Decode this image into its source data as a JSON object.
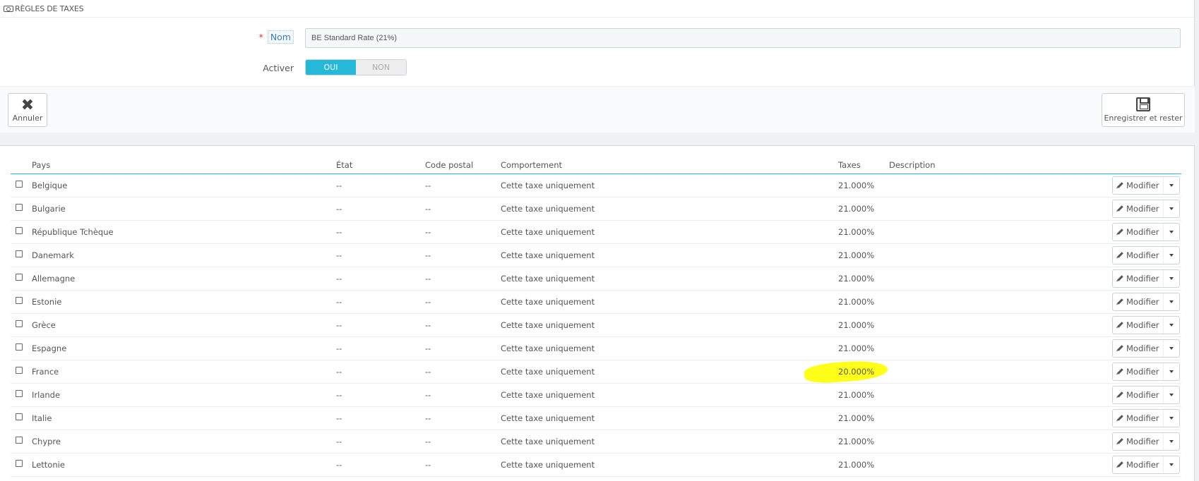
{
  "header": {
    "title": "RÈGLES DE TAXES",
    "icon": "money-icon"
  },
  "form": {
    "name_label": "Nom",
    "name_required": "*",
    "name_value": "BE Standard Rate (21%)",
    "active_label": "Activer",
    "toggle_on": "OUI",
    "toggle_off": "NON",
    "toggle_state": "on"
  },
  "footer": {
    "cancel_label": "Annuler",
    "cancel_icon": "close-icon",
    "save_label": "Enregistrer et rester",
    "save_icon": "save-icon"
  },
  "table": {
    "headers": [
      "Pays",
      "État",
      "Code postal",
      "Comportement",
      "Taxes",
      "Description"
    ],
    "action_label": "Modifier",
    "rows": [
      {
        "pays": "Belgique",
        "etat": "--",
        "cp": "--",
        "comp": "Cette taxe uniquement",
        "tax": "21.000%",
        "desc": ""
      },
      {
        "pays": "Bulgarie",
        "etat": "--",
        "cp": "--",
        "comp": "Cette taxe uniquement",
        "tax": "21.000%",
        "desc": ""
      },
      {
        "pays": "République Tchèque",
        "etat": "--",
        "cp": "--",
        "comp": "Cette taxe uniquement",
        "tax": "21.000%",
        "desc": ""
      },
      {
        "pays": "Danemark",
        "etat": "--",
        "cp": "--",
        "comp": "Cette taxe uniquement",
        "tax": "21.000%",
        "desc": ""
      },
      {
        "pays": "Allemagne",
        "etat": "--",
        "cp": "--",
        "comp": "Cette taxe uniquement",
        "tax": "21.000%",
        "desc": ""
      },
      {
        "pays": "Estonie",
        "etat": "--",
        "cp": "--",
        "comp": "Cette taxe uniquement",
        "tax": "21.000%",
        "desc": ""
      },
      {
        "pays": "Grèce",
        "etat": "--",
        "cp": "--",
        "comp": "Cette taxe uniquement",
        "tax": "21.000%",
        "desc": ""
      },
      {
        "pays": "Espagne",
        "etat": "--",
        "cp": "--",
        "comp": "Cette taxe uniquement",
        "tax": "21.000%",
        "desc": ""
      },
      {
        "pays": "France",
        "etat": "--",
        "cp": "--",
        "comp": "Cette taxe uniquement",
        "tax": "20.000%",
        "desc": "",
        "highlight": true
      },
      {
        "pays": "Irlande",
        "etat": "--",
        "cp": "--",
        "comp": "Cette taxe uniquement",
        "tax": "21.000%",
        "desc": ""
      },
      {
        "pays": "Italie",
        "etat": "--",
        "cp": "--",
        "comp": "Cette taxe uniquement",
        "tax": "21.000%",
        "desc": ""
      },
      {
        "pays": "Chypre",
        "etat": "--",
        "cp": "--",
        "comp": "Cette taxe uniquement",
        "tax": "21.000%",
        "desc": ""
      },
      {
        "pays": "Lettonie",
        "etat": "--",
        "cp": "--",
        "comp": "Cette taxe uniquement",
        "tax": "21.000%",
        "desc": ""
      }
    ]
  },
  "colors": {
    "accent": "#25b9d7",
    "highlight": "#ffff1a"
  }
}
